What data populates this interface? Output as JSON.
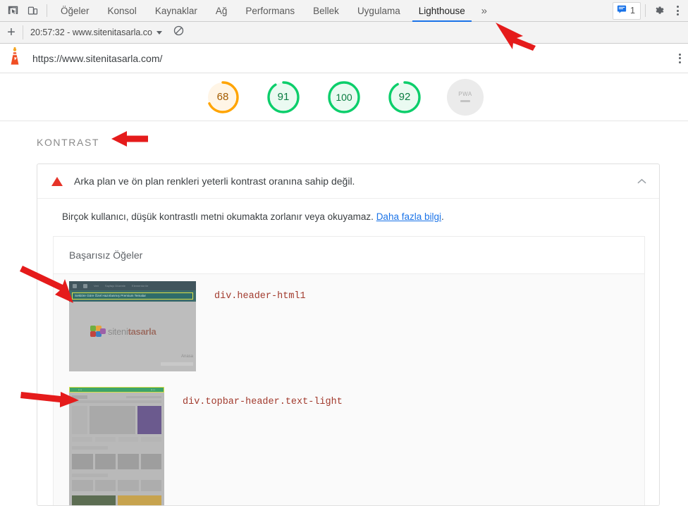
{
  "devtools": {
    "icons": {
      "inspect": "inspect-element-icon",
      "device": "device-toolbar-icon"
    },
    "tabs": [
      {
        "label": "Öğeler",
        "selected": false
      },
      {
        "label": "Konsol",
        "selected": false
      },
      {
        "label": "Kaynaklar",
        "selected": false
      },
      {
        "label": "Ağ",
        "selected": false
      },
      {
        "label": "Performans",
        "selected": false
      },
      {
        "label": "Bellek",
        "selected": false
      },
      {
        "label": "Uygulama",
        "selected": false
      },
      {
        "label": "Lighthouse",
        "selected": true
      }
    ],
    "more_tabs_label": "»",
    "messages": {
      "count": "1",
      "icon": "message-icon"
    },
    "settings_icon": "gear-icon",
    "menu_icon": "more-vertical-icon"
  },
  "lighthouse_toolbar": {
    "new_report_label": "+",
    "report_select": "20:57:32 - www.sitenitasarla.co",
    "clear_icon": "no-entry-icon"
  },
  "url_bar": {
    "lighthouse_icon": "lighthouse-icon",
    "url": "https://www.sitenitasarla.com/",
    "menu_icon": "more-vertical-icon"
  },
  "scores": [
    {
      "name": "performance",
      "value": "68",
      "color": "#ffa400",
      "bg": "#fff5e6",
      "pct": 68,
      "selected": false
    },
    {
      "name": "accessibility",
      "value": "91",
      "color": "#0cce6b",
      "bg": "#eafaf1",
      "pct": 91,
      "selected": true
    },
    {
      "name": "best-practices",
      "value": "100",
      "color": "#0cce6b",
      "bg": "#eafaf1",
      "pct": 100,
      "selected": false
    },
    {
      "name": "seo",
      "value": "92",
      "color": "#0cce6b",
      "bg": "#eafaf1",
      "pct": 92,
      "selected": false
    },
    {
      "name": "pwa",
      "value": "PWA",
      "color": "#c4c4c4",
      "bg": "#ebebeb",
      "pct": 0,
      "selected": false
    }
  ],
  "section": {
    "title": "KONTRAST"
  },
  "audit": {
    "title": "Arka plan ve ön plan renkleri yeterli kontrast oranına sahip değil.",
    "warning_icon": "warning-triangle-icon",
    "collapse_icon": "chevron-up-icon",
    "description_before": "Birçok kullanıcı, düşük kontrastlı metni okumakta zorlanır veya okuyamaz. ",
    "description_link": "Daha fazla bilgi",
    "description_after": ".",
    "table_header": "Başarısız Öğeler",
    "rows": [
      {
        "selector": "div.header-html1",
        "thumbnail": {
          "adminbar_items": [
            "Veri",
            "Sayfayı Düzenle",
            "Elementor ile"
          ],
          "banner_text": "Sektöre Göre Özel Hazırlanmış Premium Temalar",
          "logo_prefix": "siteni",
          "logo_accent": "tasarla",
          "nav_item": "Anasa"
        }
      },
      {
        "selector": "div.topbar-header.text-light",
        "thumbnail": {
          "topbar_left": "▪ ▪ ▪",
          "topbar_right": "▪▪ ▪ ▪"
        }
      }
    ]
  },
  "annotations": {
    "arrow_color": "#e51b1b",
    "arrows": [
      {
        "name": "arrow-to-lighthouse-tab"
      },
      {
        "name": "arrow-to-kontrast-heading"
      },
      {
        "name": "arrow-to-first-thumbnail"
      },
      {
        "name": "arrow-to-second-thumbnail"
      }
    ]
  }
}
